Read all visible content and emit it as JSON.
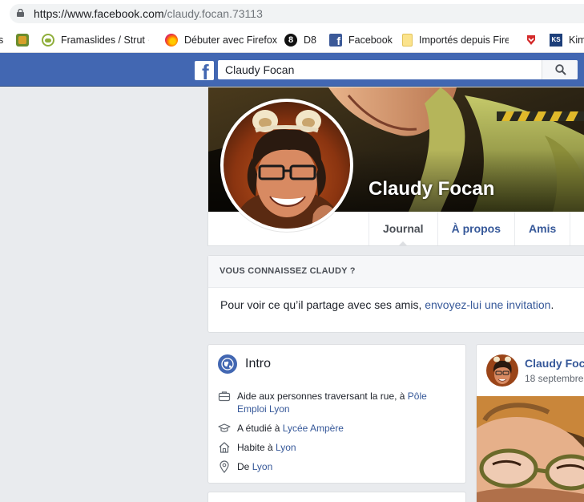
{
  "browser": {
    "url_host": "https://www.facebook.com",
    "url_path": "/claudy.focan.73113"
  },
  "bookmarks": [
    {
      "label": "s",
      "icon": "bookmark-icon"
    },
    {
      "label": "",
      "icon": "framagames-icon"
    },
    {
      "label": "Framaslides / Strut ·",
      "icon": "framaslides-icon"
    },
    {
      "label": "Débuter avec Firefox",
      "icon": "firefox-icon"
    },
    {
      "label": "D8",
      "icon": "d8-icon"
    },
    {
      "label": "Facebook",
      "icon": "facebook-icon"
    },
    {
      "label": "Importés depuis Firef",
      "icon": "folder-icon"
    },
    {
      "label": "",
      "icon": "pocket-icon"
    },
    {
      "label": "Kim",
      "icon": "ks-icon"
    }
  ],
  "header": {
    "logo": "f",
    "search_value": "Claudy Focan"
  },
  "profile": {
    "name": "Claudy Focan",
    "tabs": [
      "Journal",
      "À propos",
      "Amis"
    ],
    "active_tab": "Journal"
  },
  "know_box": {
    "title": "VOUS CONNAISSEZ CLAUDY ?",
    "text": "Pour voir ce qu’il partage avec ses amis, ",
    "link": "envoyez-lui une invitation",
    "suffix": "."
  },
  "intro": {
    "title": "Intro",
    "items": [
      {
        "icon": "briefcase-icon",
        "prefix": "Aide aux personnes traversant la rue, à ",
        "link": "Pôle Emploi Lyon"
      },
      {
        "icon": "graduation-cap-icon",
        "prefix": "A étudié à ",
        "link": "Lycée Ampère"
      },
      {
        "icon": "home-icon",
        "prefix": "Habite à ",
        "link": "Lyon"
      },
      {
        "icon": "location-pin-icon",
        "prefix": "De ",
        "link": "Lyon"
      }
    ]
  },
  "post": {
    "author": "Claudy Focan",
    "date": "18 septembre"
  },
  "colors": {
    "bluebar": "#4267b2",
    "link": "#365899",
    "page_bg": "#e9ebee"
  }
}
